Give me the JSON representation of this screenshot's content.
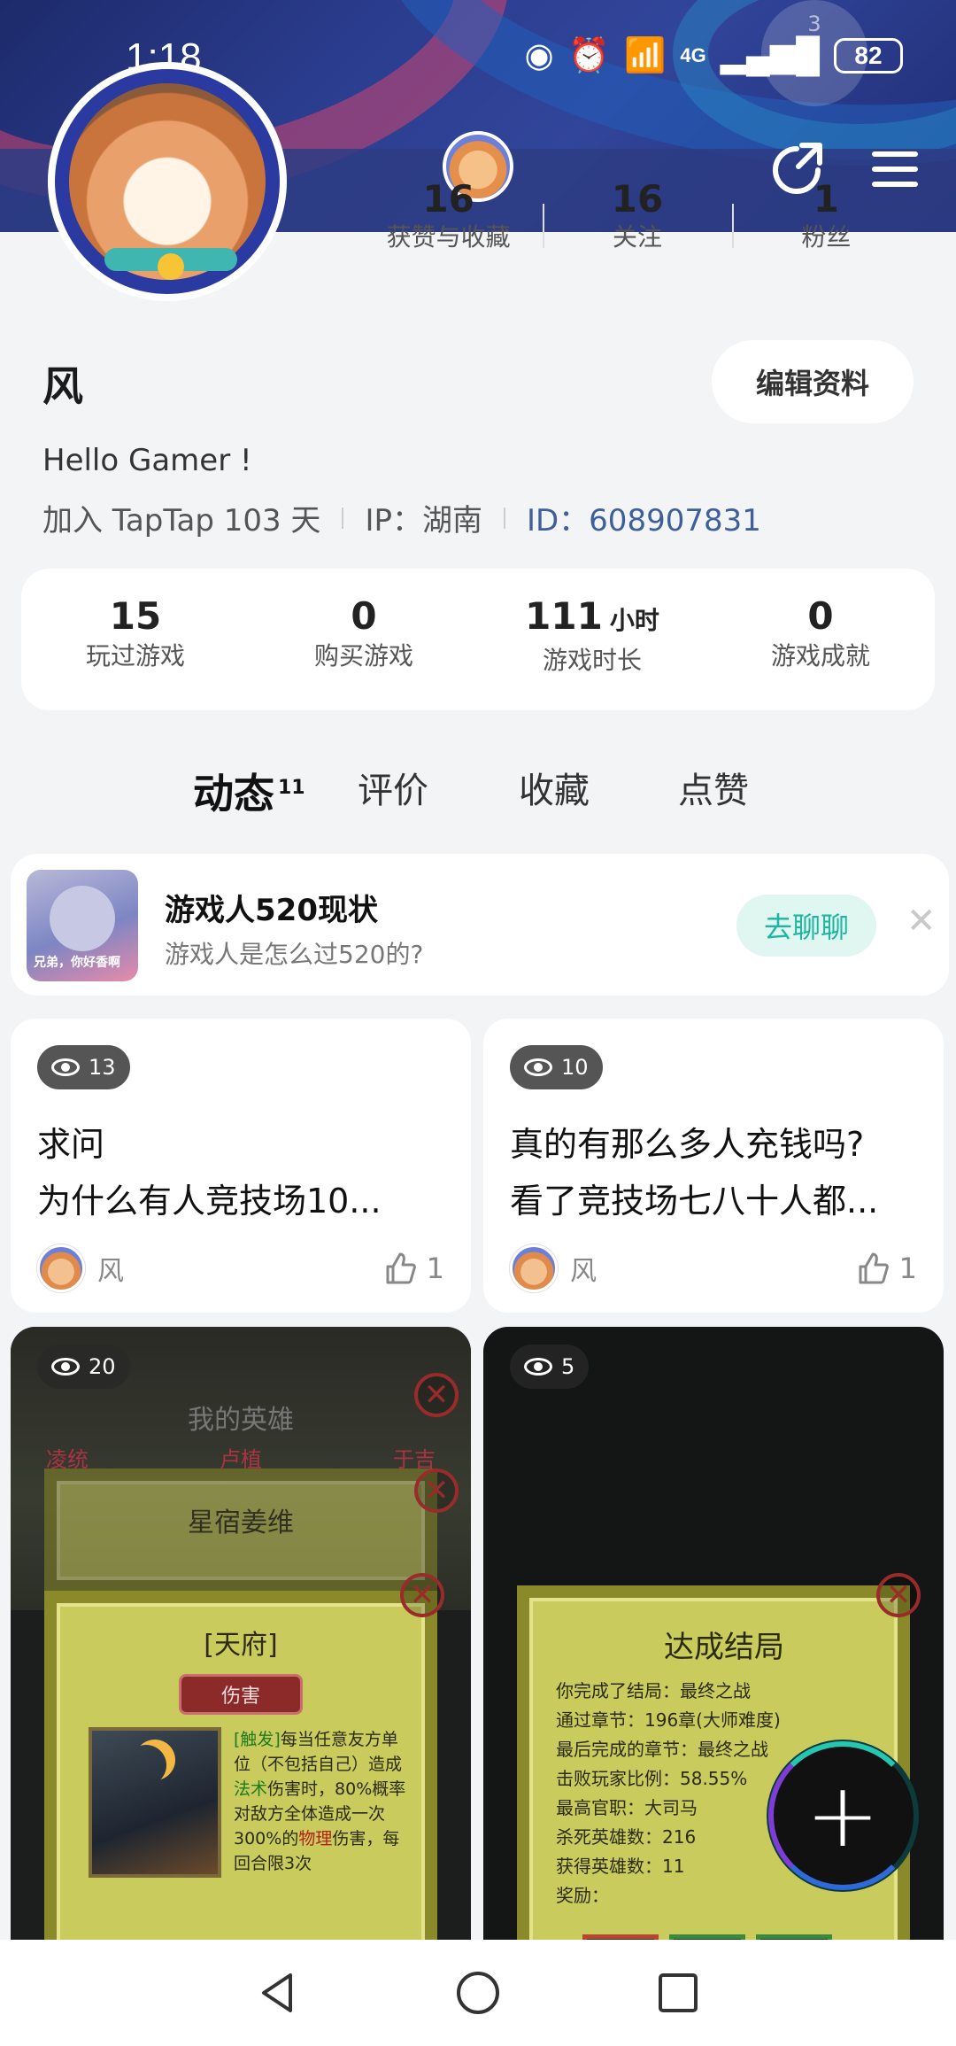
{
  "status_bar": {
    "time": "1:18",
    "network": "4G",
    "battery": "82",
    "watermark": "3"
  },
  "nav": {
    "back_icon": "chevron-left-icon",
    "share_icon": "share-icon",
    "menu_icon": "menu-icon"
  },
  "profile": {
    "counts": [
      {
        "value": "16",
        "label": "获赞与收藏"
      },
      {
        "value": "16",
        "label": "关注"
      },
      {
        "value": "1",
        "label": "粉丝"
      }
    ],
    "name": "风",
    "edit_label": "编辑资料",
    "bio": "Hello Gamer !",
    "joined": "加入 TapTap 103 天",
    "ip": "IP：湖南",
    "id": "ID：608907831"
  },
  "stats": [
    {
      "value": "15",
      "unit": "",
      "label": "玩过游戏"
    },
    {
      "value": "0",
      "unit": "",
      "label": "购买游戏"
    },
    {
      "value": "111",
      "unit": "小时",
      "label": "游戏时长"
    },
    {
      "value": "0",
      "unit": "",
      "label": "游戏成就"
    }
  ],
  "tabs": [
    {
      "label": "动态",
      "badge": "11",
      "active": true
    },
    {
      "label": "评价"
    },
    {
      "label": "收藏"
    },
    {
      "label": "点赞"
    }
  ],
  "banner": {
    "thumb_caption": "兄弟，你好香啊",
    "title": "游戏人520现状",
    "subtitle": "游戏人是怎么过520的?",
    "cta": "去聊聊"
  },
  "posts": [
    {
      "views": "13",
      "lines": [
        "求问",
        "为什么有人竞技场10..."
      ],
      "author": "风",
      "likes": "1"
    },
    {
      "views": "10",
      "lines": [
        "真的有那么多人充钱吗?",
        "看了竞技场七八十人都..."
      ],
      "author": "风",
      "likes": "1"
    }
  ],
  "image_posts": [
    {
      "views": "20",
      "screen_head": "我的英雄",
      "screen_tabs": [
        "凌统",
        "卢植",
        "于吉"
      ],
      "card_title": "星宿姜维",
      "panel_title": "[天府]",
      "tag": "伤害",
      "desc_prefix": "[触发]",
      "desc_1": "每当任意友方单位（不包括自己）造成",
      "desc_2": "法术",
      "desc_3": "伤害时，80%概率对敌方全体造成一次300%的",
      "desc_4": "物理",
      "desc_5": "伤害，每回合限3次"
    },
    {
      "views": "5",
      "result_title": "达成结局",
      "result_lines": [
        "你完成了结局：最终之战",
        "通过章节：196章(大师难度)",
        "最后完成的章节：最终之战",
        "击败玩家比例：58.55%",
        "最高官职：大司马",
        "杀死英雄数：216",
        "获得英雄数：11",
        "奖励："
      ]
    }
  ],
  "fab": {
    "icon": "plus-icon"
  },
  "system_nav": {
    "back": "back-triangle-icon",
    "home": "home-circle-icon",
    "recents": "recents-square-icon"
  }
}
